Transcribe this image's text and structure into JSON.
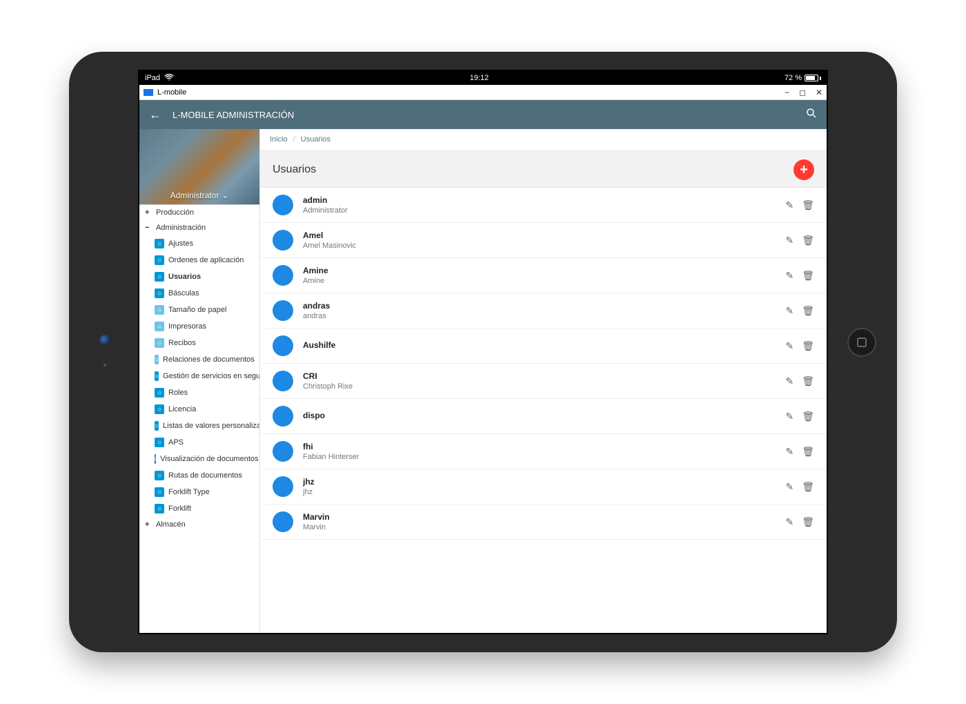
{
  "device": {
    "name": "iPad",
    "time": "19:12",
    "battery": "72 %"
  },
  "window": {
    "app_name": "L-mobile"
  },
  "header": {
    "title": "L-MOBILE ADMINISTRACIÓN"
  },
  "sidebar": {
    "role": "Administrator",
    "sections": [
      {
        "label": "Producción",
        "expanded": false
      },
      {
        "label": "Administración",
        "expanded": true,
        "children": [
          {
            "label": "Ajustes",
            "icon": "blue"
          },
          {
            "label": "Ordenes de aplicación",
            "icon": "blue"
          },
          {
            "label": "Usuarios",
            "icon": "blue",
            "active": true
          },
          {
            "label": "Básculas",
            "icon": "blue"
          },
          {
            "label": "Tamaño de papel",
            "icon": "lightblue"
          },
          {
            "label": "Impresoras",
            "icon": "lightblue"
          },
          {
            "label": "Recibos",
            "icon": "lightblue"
          },
          {
            "label": "Relaciones de documentos",
            "icon": "lightblue"
          },
          {
            "label": "Gestión de servicios en segundo p",
            "icon": "blue"
          },
          {
            "label": "Roles",
            "icon": "blue"
          },
          {
            "label": "Licencia",
            "icon": "blue"
          },
          {
            "label": "Listas de valores personalizadas",
            "icon": "blue"
          },
          {
            "label": "APS",
            "icon": "blue"
          },
          {
            "label": "Visualización de documentos",
            "icon": "info"
          },
          {
            "label": "Rutas de documentos",
            "icon": "blue"
          },
          {
            "label": "Forklift Type",
            "icon": "blue"
          },
          {
            "label": "Forklift",
            "icon": "blue"
          }
        ]
      },
      {
        "label": "Almacén",
        "expanded": false
      }
    ]
  },
  "breadcrumb": {
    "home": "Inicio",
    "current": "Usuarios"
  },
  "page": {
    "title": "Usuarios"
  },
  "users": [
    {
      "name": "admin",
      "sub": "Administrator"
    },
    {
      "name": "Amel",
      "sub": "Amel Masinovic"
    },
    {
      "name": "Amine",
      "sub": "Amine"
    },
    {
      "name": "andras",
      "sub": "andras"
    },
    {
      "name": "Aushilfe",
      "sub": ""
    },
    {
      "name": "CRI",
      "sub": "Christoph Rixe"
    },
    {
      "name": "dispo",
      "sub": ""
    },
    {
      "name": "fhi",
      "sub": "Fabian Hinterser"
    },
    {
      "name": "jhz",
      "sub": "jhz"
    },
    {
      "name": "Marvin",
      "sub": "Marvin"
    }
  ],
  "colors": {
    "header": "#4f6d7a",
    "accent": "#1e88e5",
    "fab": "#ff3b30"
  }
}
